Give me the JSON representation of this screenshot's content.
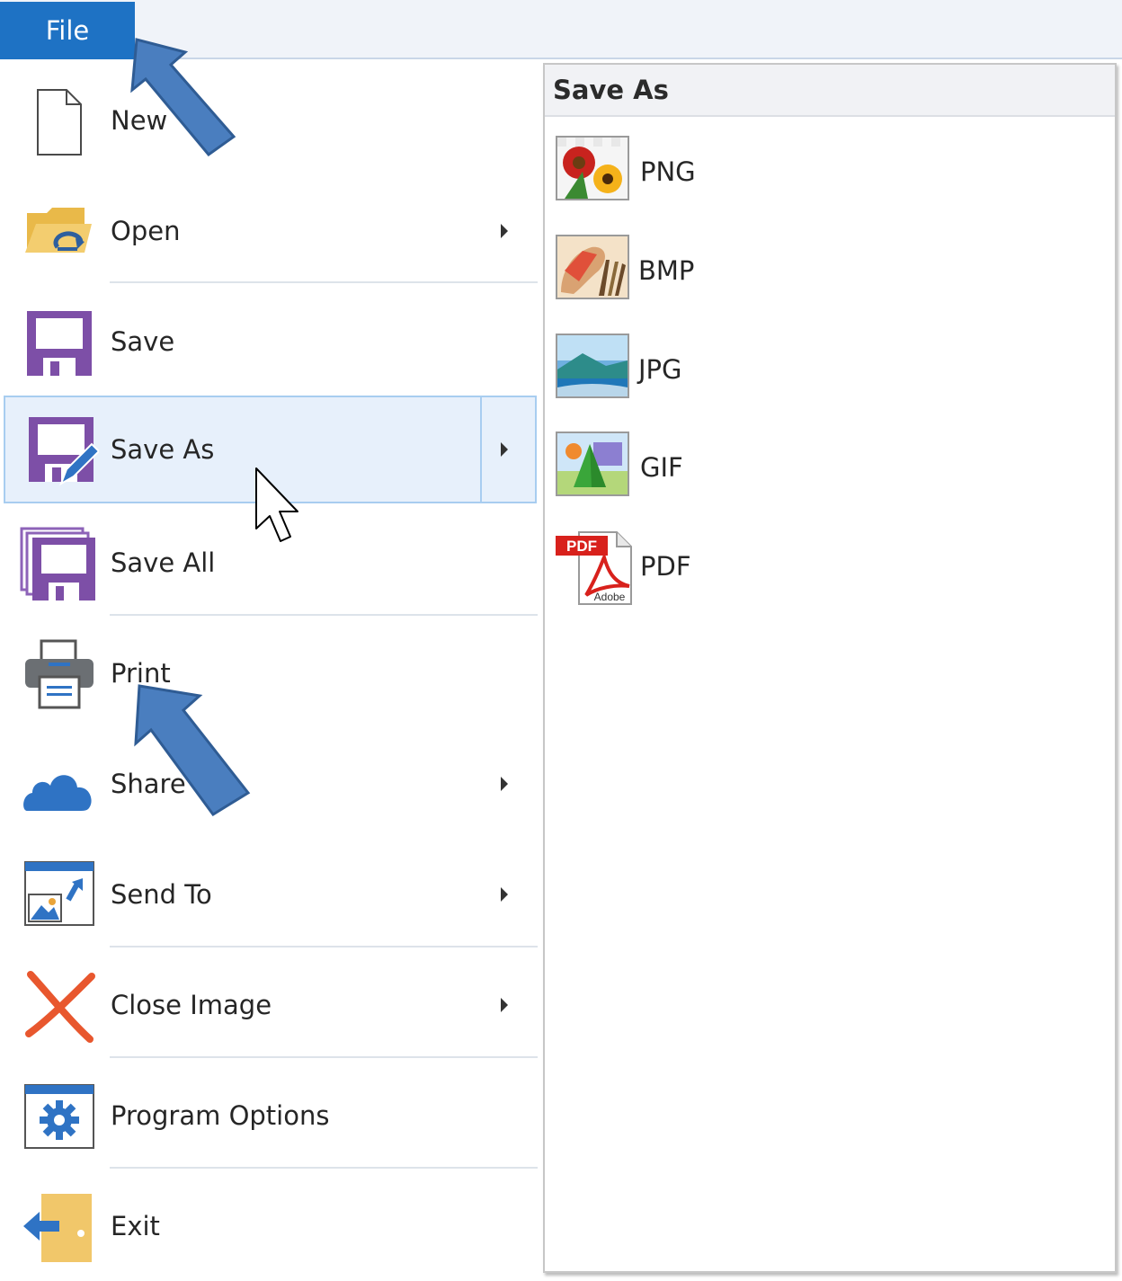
{
  "ribbon": {
    "file_tab_label": "File"
  },
  "menu": {
    "items": [
      {
        "label": "New",
        "icon": "new-document-icon"
      },
      {
        "label": "Open",
        "icon": "open-folder-icon",
        "has_submenu": true
      },
      {
        "label": "Save",
        "icon": "save-disk-icon"
      },
      {
        "label": "Save As",
        "icon": "save-as-icon",
        "has_submenu": true,
        "selected": true
      },
      {
        "label": "Save All",
        "icon": "save-all-icon"
      },
      {
        "label": "Print",
        "icon": "printer-icon"
      },
      {
        "label": "Share",
        "icon": "cloud-icon",
        "has_submenu": true
      },
      {
        "label": "Send To",
        "icon": "send-to-icon",
        "has_submenu": true
      },
      {
        "label": "Close Image",
        "icon": "close-x-icon",
        "has_submenu": true
      },
      {
        "label": "Program Options",
        "icon": "settings-gear-icon"
      },
      {
        "label": "Exit",
        "icon": "exit-door-icon"
      }
    ]
  },
  "submenu": {
    "title": "Save As",
    "formats": [
      {
        "label": "PNG",
        "icon": "png-image-icon"
      },
      {
        "label": "BMP",
        "icon": "bmp-image-icon"
      },
      {
        "label": "JPG",
        "icon": "jpg-image-icon"
      },
      {
        "label": "GIF",
        "icon": "gif-image-icon"
      },
      {
        "label": "PDF",
        "icon": "pdf-document-icon",
        "badge_text": "PDF",
        "brand_text": "Adobe"
      }
    ]
  },
  "annotations": {
    "arrow_color": "#4a7ebf",
    "arrow_outline_color": "#2f5c94"
  },
  "colors": {
    "accent": "#1e72c4",
    "selection_bg": "#e7f0fb",
    "selection_border": "#a8cdf0",
    "save_icon_purple": "#7d4fa7"
  }
}
